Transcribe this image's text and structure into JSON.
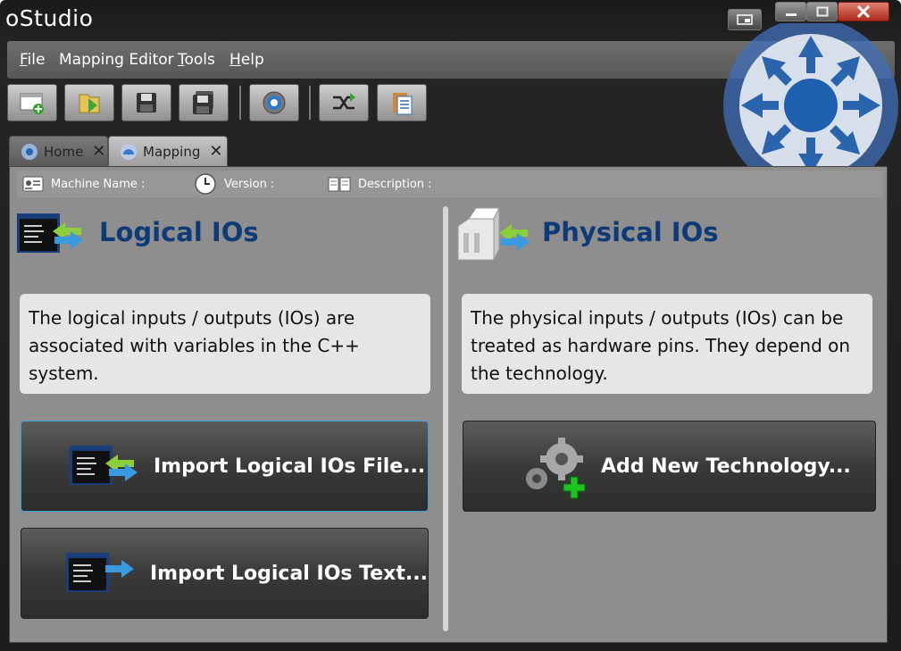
{
  "window": {
    "title": "oStudio"
  },
  "menubar": {
    "items": [
      {
        "label": "File"
      },
      {
        "label": "Mapping Editor"
      },
      {
        "label": "Tools"
      },
      {
        "label": "Help"
      }
    ]
  },
  "toolbar": {
    "buttons": [
      {
        "icon": "new-document-icon"
      },
      {
        "icon": "open-folder-icon"
      },
      {
        "icon": "save-icon"
      },
      {
        "icon": "save-all-icon"
      },
      {
        "icon": "settings-icon"
      },
      {
        "icon": "mapping-icon"
      },
      {
        "icon": "clipboard-icon"
      }
    ]
  },
  "tabs": [
    {
      "label": "Home",
      "active": false
    },
    {
      "label": "Mapping",
      "active": true
    }
  ],
  "infobar": {
    "machine_name_label": "Machine Name :",
    "version_label": "Version :",
    "description_label": "Description :"
  },
  "logical": {
    "heading": "Logical IOs",
    "description": "The logical inputs / outputs (IOs) are associated with variables in the C++ system.",
    "import_file_button": "Import Logical IOs File...",
    "import_text_button": "Import Logical IOs Text..."
  },
  "physical": {
    "heading": "Physical IOs",
    "description": "The physical inputs / outputs (IOs) can be treated as hardware pins. They depend on the technology.",
    "add_technology_button": "Add New Technology..."
  },
  "colors": {
    "heading": "#0f3a78",
    "accent_focus": "#3aa0d8",
    "close_button": "#c0392b"
  }
}
